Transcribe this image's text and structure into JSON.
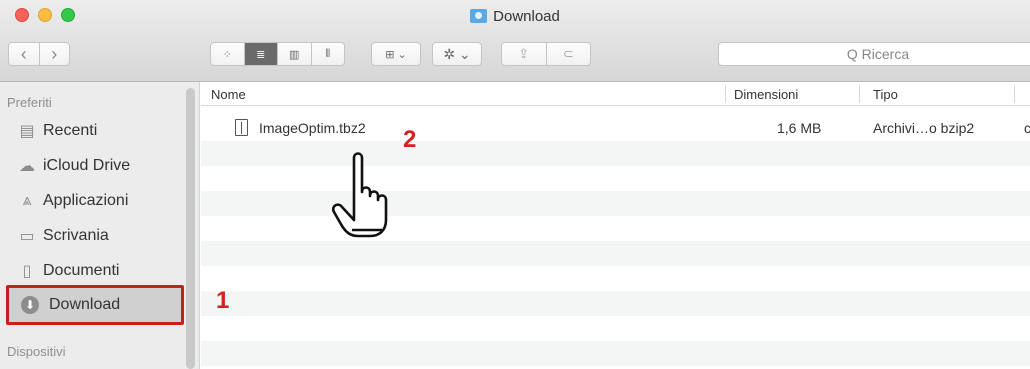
{
  "window": {
    "title": "Download"
  },
  "toolbar": {
    "back_label": "‹",
    "forward_label": "›",
    "view_icons": [
      "⁘",
      "≣",
      "▥",
      "⫴"
    ],
    "arrange_label": "⊞ ⌄",
    "action_label": "✲ ⌄",
    "share_label": "⇪",
    "tag_label": "⊂",
    "search_placeholder": "Q Ricerca"
  },
  "sidebar": {
    "favorites_heading": "Preferiti",
    "items": [
      {
        "label": "Recenti",
        "icon": "recents-icon",
        "glyph": "▤"
      },
      {
        "label": "iCloud Drive",
        "icon": "cloud-icon",
        "glyph": "☁"
      },
      {
        "label": "Applicazioni",
        "icon": "applications-icon",
        "glyph": "⩓"
      },
      {
        "label": "Scrivania",
        "icon": "desktop-icon",
        "glyph": "▭"
      },
      {
        "label": "Documenti",
        "icon": "documents-icon",
        "glyph": "▯"
      },
      {
        "label": "Download",
        "icon": "download-icon",
        "glyph": "⬇"
      }
    ],
    "devices_heading": "Dispositivi"
  },
  "columns": {
    "name": "Nome",
    "size": "Dimensioni",
    "kind": "Tipo"
  },
  "files": [
    {
      "name": "ImageOptim.tbz2",
      "size": "1,6 MB",
      "kind": "Archivi…o bzip2",
      "extra": "c"
    }
  ],
  "annotations": {
    "step1": "1",
    "step2": "2"
  },
  "colors": {
    "selection_outline": "#c81e1e",
    "annotation": "#d8211e"
  }
}
